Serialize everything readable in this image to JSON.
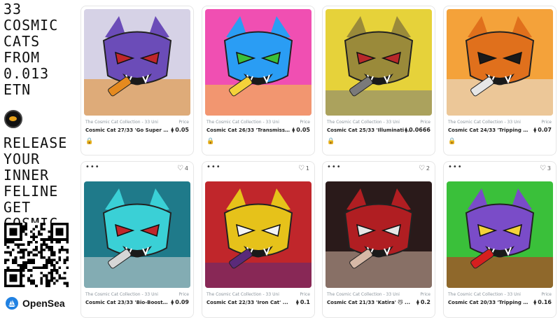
{
  "promo": {
    "headline_lines": [
      {
        "text": "33",
        "bold": false
      },
      {
        "text": "COSMIC",
        "bold": true
      },
      {
        "text": "CATS",
        "bold": true
      },
      {
        "text": "FROM",
        "bold": false
      },
      {
        "text": "0.013",
        "bold": false
      },
      {
        "text": "ETN",
        "bold": true
      }
    ],
    "release_lines": [
      "RELEASE",
      "YOUR",
      "INNER",
      "FELINE",
      "GET",
      "COSMIC"
    ],
    "logo_icon": "cosmic-cat-logo-icon",
    "qr_icon": "qr-code-icon",
    "marketplace_label": "OpenSea",
    "marketplace_icon": "opensea-icon",
    "accent_color": "#2081e2"
  },
  "cards_top": [
    {
      "collection": "The Cosmic Cat Collection - 33 Uni",
      "price_label": "Price",
      "name": "Cosmic Cat 27/33 'Go Super S...",
      "price": "0.05",
      "lock": "🔒",
      "colors": [
        "#6b4cb8",
        "#d6d2e6",
        "#c0262b",
        "#e58a1f"
      ]
    },
    {
      "collection": "The Cosmic Cat Collection - 33 Uni",
      "price_label": "Price",
      "name": "Cosmic Cat 26/33 'Transmissi...",
      "price": "0.05",
      "lock": "🔒",
      "colors": [
        "#2a9df4",
        "#f04fb2",
        "#3ac03a",
        "#f4d23a"
      ]
    },
    {
      "collection": "The Cosmic Cat Collection - 33 Uni",
      "price_label": "Price",
      "name": "Cosmic Cat 25/33 'Illuminati R...",
      "price": "0.0666",
      "lock": "🔒",
      "colors": [
        "#9a8a3a",
        "#e6d23a",
        "#b8282a",
        "#7a7a7a"
      ]
    },
    {
      "collection": "The Cosmic Cat Collection - 33 Uni",
      "price_label": "Price",
      "name": "Cosmic Cat 24/33 'Tripping M...",
      "price": "0.07",
      "lock": "🔒",
      "colors": [
        "#e0701c",
        "#f4a23a",
        "#1a1a1a",
        "#e6e6e6"
      ]
    }
  ],
  "cards_bottom": [
    {
      "likes": "4",
      "collection": "The Cosmic Cat Collection - 33 Uni",
      "price_label": "Price",
      "name": "Cosmic Cat 23/33 'Bio-Booste...",
      "price": "0.09",
      "colors": [
        "#3ad0d6",
        "#1f7a8a",
        "#c0262b",
        "#d6d6d6"
      ]
    },
    {
      "likes": "1",
      "collection": "The Cosmic Cat Collection - 33 Uni",
      "price_label": "Price",
      "name": "Cosmic Cat 22/33 'Iron Cat' ...",
      "price": "0.1",
      "colors": [
        "#e6c21a",
        "#c0262b",
        "#f4f4f4",
        "#5a2a7a"
      ]
    },
    {
      "likes": "2",
      "collection": "The Cosmic Cat Collection - 33 Uni",
      "price_label": "Price",
      "name": "Cosmic Cat 21/33 'Katira' 😼 ...",
      "price": "0.2",
      "colors": [
        "#b01e22",
        "#2a1a1a",
        "#e6e6e6",
        "#d6b8a6"
      ]
    },
    {
      "likes": "3",
      "collection": "The Cosmic Cat Collection - 33 Uni",
      "price_label": "Price",
      "name": "Cosmic Cat 20/33 'Tripping D...",
      "price": "0.16",
      "colors": [
        "#7a4cc8",
        "#3ac03a",
        "#f4d23a",
        "#d61f1f"
      ]
    }
  ],
  "card_badges": {
    "more_label": "•••",
    "heart": "♡",
    "eth": "⧫"
  }
}
